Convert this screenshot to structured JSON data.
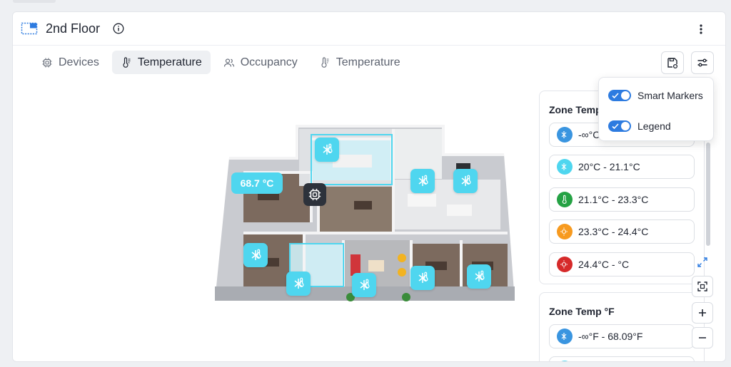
{
  "header": {
    "title": "2nd Floor"
  },
  "tabs": [
    {
      "label": "Devices",
      "icon": "chip-icon",
      "active": false
    },
    {
      "label": "Temperature",
      "icon": "thermometer-icon",
      "active": true
    },
    {
      "label": "Occupancy",
      "icon": "users-icon",
      "active": false
    },
    {
      "label": "Temperature",
      "icon": "thermometer-icon",
      "active": false
    }
  ],
  "floorplan": {
    "temperature_readout": "68.7 °C"
  },
  "legend_c": {
    "title": "Zone Temp",
    "ranges": [
      {
        "label": "-∞°C",
        "color": "#3a95e0"
      },
      {
        "label": "20°C - 21.1°C",
        "color": "#4fd6ef"
      },
      {
        "label": "21.1°C - 23.3°C",
        "color": "#25a244"
      },
      {
        "label": "23.3°C - 24.4°C",
        "color": "#f79a1f"
      },
      {
        "label": "24.4°C - °C",
        "color": "#d62a2a"
      }
    ]
  },
  "legend_f": {
    "title": "Zone Temp °F",
    "ranges": [
      {
        "label": "-∞°F - 68.09°F",
        "color": "#3a95e0"
      }
    ]
  },
  "popover": {
    "smart_markers_label": "Smart Markers",
    "smart_markers_on": true,
    "legend_label": "Legend",
    "legend_on": true
  },
  "colors": {
    "marker": "#4fd6ef",
    "accent": "#2d7be0",
    "device": "#2d323b"
  }
}
